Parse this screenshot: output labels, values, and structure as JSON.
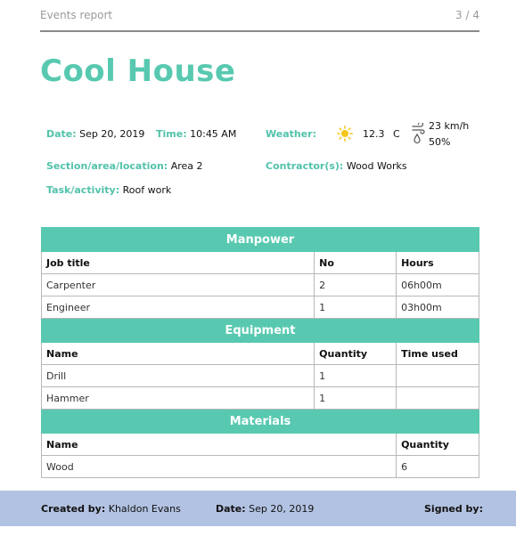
{
  "header": {
    "doc_title": "Events report",
    "page": "3 / 4"
  },
  "title": "Cool House",
  "info": {
    "date_label": "Date:",
    "date": "Sep 20, 2019",
    "time_label": "Time:",
    "time": "10:45 AM",
    "weather_label": "Weather:",
    "temperature": "12.3",
    "temperature_unit": "C",
    "wind": "23 km/h",
    "humidity": "50%",
    "weather_icon": "sun-icon",
    "wind_icon": "wind-icon",
    "section_label": "Section/area/location:",
    "section": "Area 2",
    "contractor_label": "Contractor(s):",
    "contractor": "Wood Works",
    "task_label": "Task/activity:",
    "task": "Roof work"
  },
  "manpower": {
    "title": "Manpower",
    "headers": [
      "Job title",
      "No",
      "Hours"
    ],
    "rows": [
      [
        "Carpenter",
        "2",
        "06h00m"
      ],
      [
        "Engineer",
        "1",
        "03h00m"
      ]
    ]
  },
  "equipment": {
    "title": "Equipment",
    "headers": [
      "Name",
      "Quantity",
      "Time used"
    ],
    "rows": [
      [
        "Drill",
        "1",
        ""
      ],
      [
        "Hammer",
        "1",
        ""
      ]
    ]
  },
  "materials": {
    "title": "Materials",
    "headers": [
      "Name",
      "Quantity"
    ],
    "rows": [
      [
        "Wood",
        "6"
      ]
    ]
  },
  "footer": {
    "created_by_label": "Created by:",
    "created_by": "Khaldon Evans",
    "date_label": "Date:",
    "date": "Sep 20, 2019",
    "signed_by_label": "Signed by:"
  },
  "colors": {
    "accent": "#58c9b0",
    "footer_bg": "#b2c2e2",
    "sun": "#f5c518"
  }
}
